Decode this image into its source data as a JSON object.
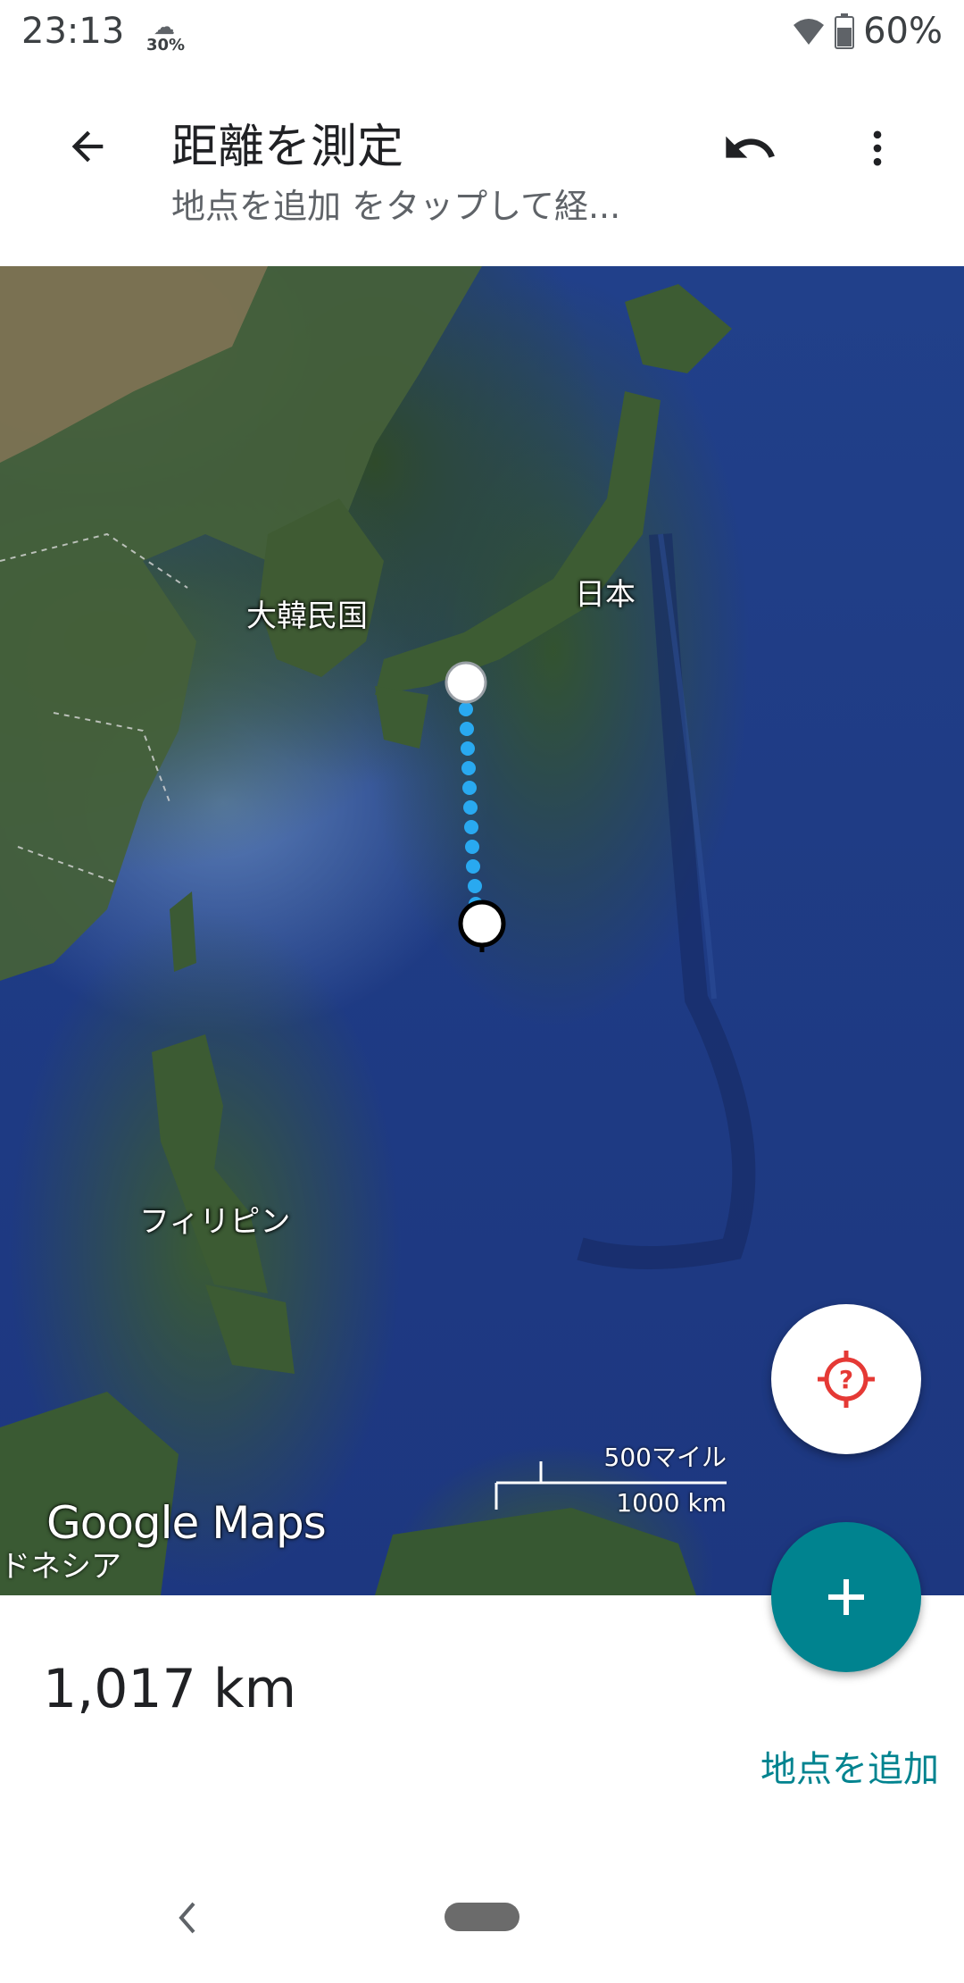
{
  "status_bar": {
    "time": "23:13",
    "weather_percent": "30%",
    "battery_percent": "60%"
  },
  "appbar": {
    "title": "距離を測定",
    "subtitle": "地点を追加 をタップして経..."
  },
  "map": {
    "labels": {
      "korea": "大韓民国",
      "japan": "日本",
      "philippines": "フィリピン",
      "indonesia_cut": "ドネシア"
    },
    "scale_miles": "500マイル",
    "scale_km": "1000 km",
    "logo": "Google Maps"
  },
  "measurement": {
    "distance": "1,017 km",
    "add_point_label": "地点を追加"
  },
  "colors": {
    "accent": "#00838f",
    "measure_line": "#29a9f0",
    "locate_icon": "#e53935"
  },
  "icons": {
    "back": "arrow-back-icon",
    "undo": "undo-icon",
    "more": "more-vert-icon",
    "locate": "location-unknown-icon",
    "add": "plus-icon"
  }
}
